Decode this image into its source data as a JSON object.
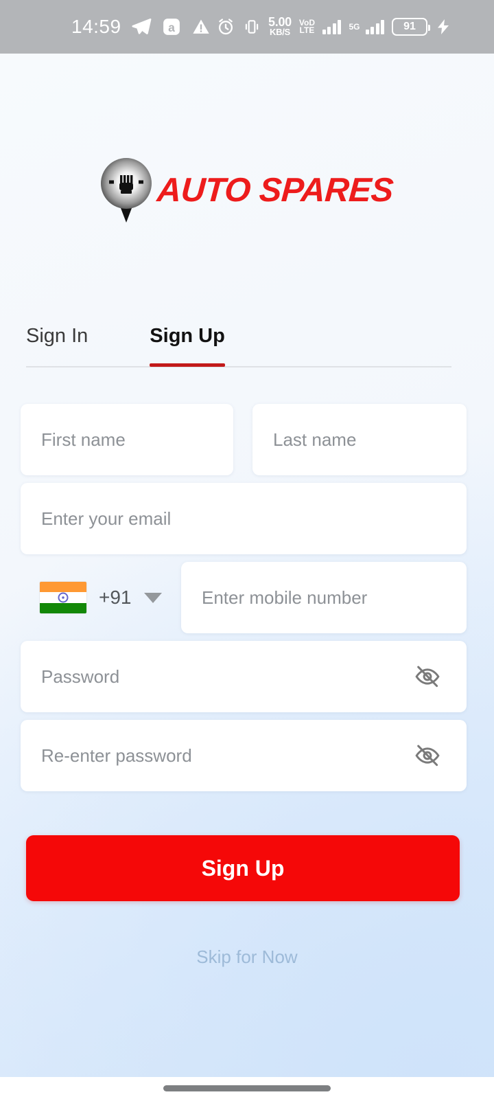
{
  "status_bar": {
    "time": "14:59",
    "left_icons": [
      "telegram-icon",
      "amazon-icon",
      "warning-triangle-icon"
    ],
    "alarm_icon": "alarm-clock-icon",
    "vibrate_icon": "vibrate-icon",
    "net_speed_value": "5.00",
    "net_speed_unit": "KB/S",
    "volte_line1": "VoD",
    "volte_line2": "LTE",
    "sim1_signal": "signal-bars-icon",
    "network_type": "5G",
    "sim2_signal": "signal-bars-icon",
    "battery_level": "91",
    "charging_icon": "charging-bolt-icon",
    "background_color": "#b3b5b8"
  },
  "brand": {
    "logo_icon": "auto-spares-pin-logo",
    "name": "AUTO SPARES",
    "color": "#ed1c1c"
  },
  "tabs": {
    "items": [
      {
        "label": "Sign In",
        "active": false
      },
      {
        "label": "Sign Up",
        "active": true
      }
    ],
    "active_indicator_color": "#c21a1a"
  },
  "form": {
    "first_name": {
      "value": "",
      "placeholder": "First name"
    },
    "last_name": {
      "value": "",
      "placeholder": "Last name"
    },
    "email": {
      "value": "",
      "placeholder": "Enter your email"
    },
    "country_code": {
      "flag": "india-flag-icon",
      "code": "+91",
      "dropdown_icon": "chevron-down-icon"
    },
    "mobile": {
      "value": "",
      "placeholder": "Enter mobile number"
    },
    "password": {
      "value": "",
      "placeholder": "Password",
      "toggle_icon": "eye-off-icon"
    },
    "confirm_password": {
      "value": "",
      "placeholder": "Re-enter password",
      "toggle_icon": "eye-off-icon"
    }
  },
  "actions": {
    "primary_label": "Sign Up",
    "primary_color": "#f50808",
    "skip_label": "Skip for Now",
    "skip_color": "#9dbad8"
  },
  "nav": {
    "gesture_bar": "home-gesture-bar"
  },
  "theme": {
    "page_background_top": "#f7fafd",
    "page_background_bottom": "#d8e8fb",
    "field_background": "#ffffff",
    "placeholder_color": "#8d9196"
  }
}
